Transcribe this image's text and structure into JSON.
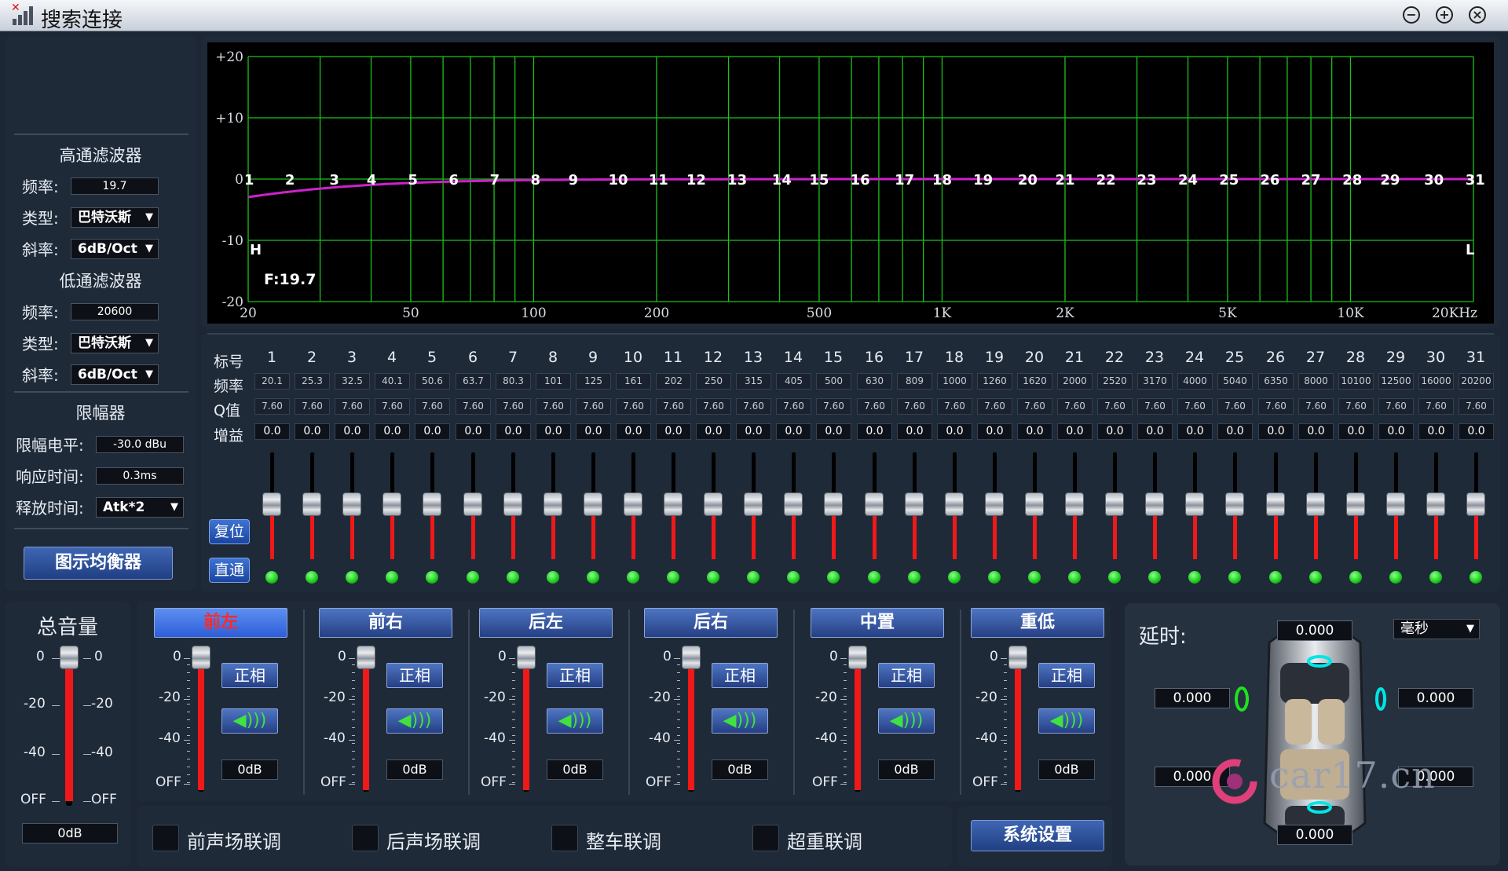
{
  "window": {
    "title": "搜索连接"
  },
  "hpf": {
    "title": "高通滤波器",
    "freq_label": "频率:",
    "freq": "19.7",
    "type_label": "类型:",
    "type": "巴特沃斯",
    "slope_label": "斜率:",
    "slope": "6dB/Oct"
  },
  "lpf": {
    "title": "低通滤波器",
    "freq_label": "频率:",
    "freq": "20600",
    "type_label": "类型:",
    "type": "巴特沃斯",
    "slope_label": "斜率:",
    "slope": "6dB/Oct"
  },
  "limiter": {
    "title": "限幅器",
    "level_label": "限幅电平:",
    "level": "-30.0 dBu",
    "attack_label": "响应时间:",
    "attack": "0.3ms",
    "release_label": "释放时间:",
    "release": "Atk*2"
  },
  "geq_button": "图示均衡器",
  "graph": {
    "y_labels": [
      "+20",
      "+10",
      "0",
      "-10",
      "-20"
    ],
    "x_labels": [
      "20",
      "50",
      "100",
      "200",
      "500",
      "1K",
      "2K",
      "5K",
      "10K",
      "20KHz"
    ],
    "hp_marker": "H",
    "lp_marker": "L",
    "freq_readout": "F:19.7",
    "colors": {
      "grid": "#1bc21b",
      "curve": "#cc22cc"
    }
  },
  "eq_table": {
    "row_labels": {
      "index": "标号",
      "freq": "频率",
      "q": "Q值",
      "gain": "增益"
    },
    "bands": [
      "1",
      "2",
      "3",
      "4",
      "5",
      "6",
      "7",
      "8",
      "9",
      "10",
      "11",
      "12",
      "13",
      "14",
      "15",
      "16",
      "17",
      "18",
      "19",
      "20",
      "21",
      "22",
      "23",
      "24",
      "25",
      "26",
      "27",
      "28",
      "29",
      "30",
      "31"
    ],
    "freqs": [
      "20.1",
      "25.3",
      "32.5",
      "40.1",
      "50.6",
      "63.7",
      "80.3",
      "101",
      "125",
      "161",
      "202",
      "250",
      "315",
      "405",
      "500",
      "630",
      "809",
      "1000",
      "1260",
      "1620",
      "2000",
      "2520",
      "3170",
      "4000",
      "5040",
      "6350",
      "8000",
      "10100",
      "12500",
      "16000",
      "20200"
    ],
    "q": "7.60",
    "gains": [
      "0.0",
      "0.0",
      "0.0",
      "0.0",
      "0.0",
      "0.0",
      "0.0",
      "0.0",
      "0.0",
      "0.0",
      "0.0",
      "0.0",
      "0.0",
      "0.0",
      "0.0",
      "0.0",
      "0.0",
      "0.0",
      "0.0",
      "0.0",
      "0.0",
      "0.0",
      "0.0",
      "0.0",
      "0.0",
      "0.0",
      "0.0",
      "0.0",
      "0.0",
      "0.0",
      "0.0"
    ],
    "reset_label": "复位",
    "bypass_label": "直通"
  },
  "master": {
    "title": "总音量",
    "scale": [
      "0",
      "-20",
      "-40",
      "OFF"
    ],
    "value": "0dB"
  },
  "channels": [
    {
      "name": "前左",
      "selected": true,
      "phase": "正相",
      "db": "0dB"
    },
    {
      "name": "前右",
      "selected": false,
      "phase": "正相",
      "db": "0dB"
    },
    {
      "name": "后左",
      "selected": false,
      "phase": "正相",
      "db": "0dB"
    },
    {
      "name": "后右",
      "selected": false,
      "phase": "正相",
      "db": "0dB"
    },
    {
      "name": "中置",
      "selected": false,
      "phase": "正相",
      "db": "0dB"
    },
    {
      "name": "重低",
      "selected": false,
      "phase": "正相",
      "db": "0dB"
    }
  ],
  "channel_scale": [
    "0",
    "-20",
    "-40",
    "OFF"
  ],
  "link_options": [
    "前声场联调",
    "后声场联调",
    "整车联调",
    "超重联调"
  ],
  "system_button": "系统设置",
  "delay": {
    "label": "延时:",
    "unit": "毫秒",
    "front_center": "0.000",
    "front_left": "0.000",
    "front_right": "0.000",
    "rear_left": "0.000",
    "rear_right": "0.000",
    "sub": "0.000"
  },
  "watermark": "car17.cn"
}
